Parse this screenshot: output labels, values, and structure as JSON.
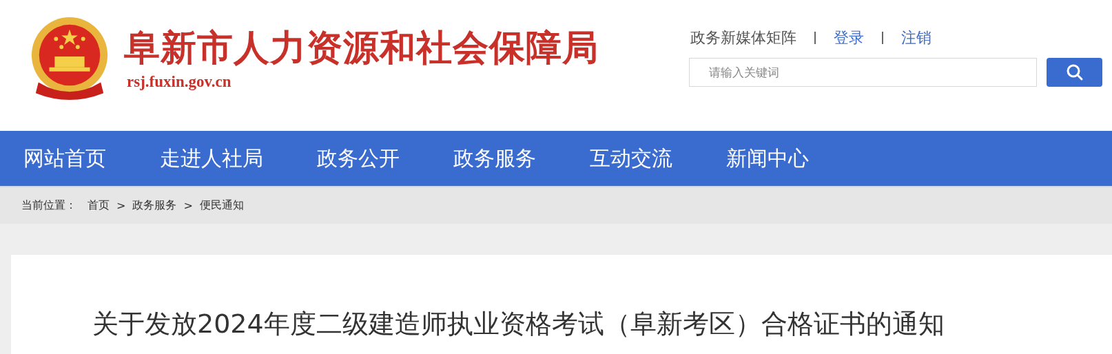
{
  "header": {
    "site_name": "阜新市人力资源和社会保障局",
    "domain": "rsj.fuxin.gov.cn",
    "top_links": [
      {
        "label": "政务新媒体矩阵",
        "kind": "plain"
      },
      {
        "label": "登录",
        "kind": "link"
      },
      {
        "label": "注销",
        "kind": "link"
      }
    ],
    "search": {
      "placeholder": "请输入关键词"
    }
  },
  "nav": [
    {
      "label": "网站首页"
    },
    {
      "label": "走进人社局"
    },
    {
      "label": "政务公开"
    },
    {
      "label": "政务服务"
    },
    {
      "label": "互动交流"
    },
    {
      "label": "新闻中心"
    }
  ],
  "breadcrumb": {
    "label": "当前位置：",
    "items": [
      "首页",
      "政务服务",
      "便民通知"
    ],
    "separator": ">"
  },
  "article": {
    "title": "关于发放2024年度二级建造师执业资格考试（阜新考区）合格证书的通知"
  }
}
